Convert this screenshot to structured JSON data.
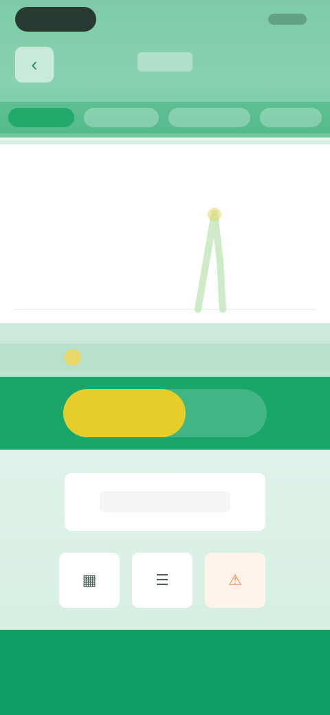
{
  "header": {
    "title": "",
    "back_icon": "back-arrow-icon",
    "tabs": [
      {
        "label": ""
      },
      {
        "label": ""
      },
      {
        "label": ""
      },
      {
        "label": ""
      }
    ]
  },
  "chart": {
    "title": "",
    "accent_color": "#e7d86a",
    "line_color": "#bfe6b8"
  },
  "info": {
    "texts": [
      "",
      "",
      "",
      ""
    ]
  },
  "toggle": {
    "left_label": "",
    "right_label": ""
  },
  "actions": {
    "primary_label": "",
    "icons": [
      {
        "name": "grid-icon"
      },
      {
        "name": "list-icon"
      },
      {
        "name": "alert-icon"
      }
    ]
  },
  "colors": {
    "header_green": "#7fcaa6",
    "band_green": "#1aa56a",
    "bottom_green": "#0f9f64",
    "toggle_yellow": "#e5cd2a",
    "warn_orange": "#f08a4c"
  }
}
